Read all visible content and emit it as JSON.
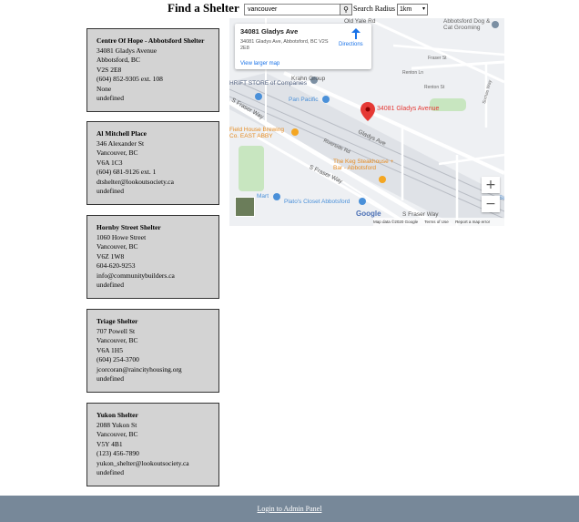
{
  "header": {
    "title": "Find a Shelter",
    "search_value": "vancouver",
    "search_icon": "search-icon",
    "radius_label": "Search Radius",
    "radius_value": "1km"
  },
  "shelters": [
    {
      "name": "Centre Of Hope - Abbotsford Shelter",
      "street": "34081 Gladys Avenue",
      "city": "Abbotsford, BC",
      "postal": "V2S 2E8",
      "phone": "(604) 852-9305 ext. 108",
      "email": "None",
      "extra": "undefined"
    },
    {
      "name": "Al Mitchell Place",
      "street": "346 Alexander St",
      "city": "Vancouver, BC",
      "postal": "V6A 1C3",
      "phone": "(604) 681-9126 ext. 1",
      "email": "dtshelter@lookoutsociety.ca",
      "extra": "undefined"
    },
    {
      "name": "Hornby Street Shelter",
      "street": "1060 Howe Street",
      "city": "Vancouver, BC",
      "postal": "V6Z 1W8",
      "phone": "604-620-9253",
      "email": "info@communitybuilders.ca",
      "extra": "undefined"
    },
    {
      "name": "Triage Shelter",
      "street": "707 Powell St",
      "city": "Vancouver, BC",
      "postal": "V6A 1H5",
      "phone": "(604) 254-3700",
      "email": "jcorcoran@raincityhousing.org",
      "extra": "undefined"
    },
    {
      "name": "Yukon Shelter",
      "street": "2088 Yukon St",
      "city": "Vancouver, BC",
      "postal": "V5Y 4B1",
      "phone": "(123) 456-7890",
      "email": "yukon_shelter@lookoutsociety.ca",
      "extra": "undefined"
    }
  ],
  "map": {
    "info_title": "34081 Gladys Ave",
    "info_address": "34081 Gladys Ave, Abbotsford, BC V2S 2E8",
    "directions_label": "Directions",
    "larger_map_label": "View larger map",
    "pin_label": "34081 Gladys Avenue",
    "zoom_in": "+",
    "zoom_out": "−",
    "google_logo": "Google",
    "footer_data": "Map data ©2020 Google",
    "footer_terms": "Terms of Use",
    "footer_report": "Report a map error",
    "labels": {
      "old_yale": "Old Yale Rd",
      "dog_grooming": "Abbotsford Dog & Cat Grooming",
      "fraser_st": "Fraser St",
      "renton_ln": "Renton Ln",
      "renton_st": "Renton St",
      "sumas_way": "Sumas Way",
      "thrift": "HRIFT STORE of Companies",
      "krahn": "Krahn Group",
      "pan_pacific": "Pan Pacific",
      "fraser_way": "S Fraser Way",
      "field_house": "Field House Brewing Co. EAST ABBY",
      "gladys_ave": "Gladys Ave",
      "riverside": "Riverside Rd",
      "keg": "The Keg Steakhouse + Bar - Abbotsford",
      "mart": "Mart",
      "platos": "Plato's Closet Abbotsford",
      "sumas": "Su"
    }
  },
  "footer": {
    "admin_link": "Login to Admin Panel"
  }
}
